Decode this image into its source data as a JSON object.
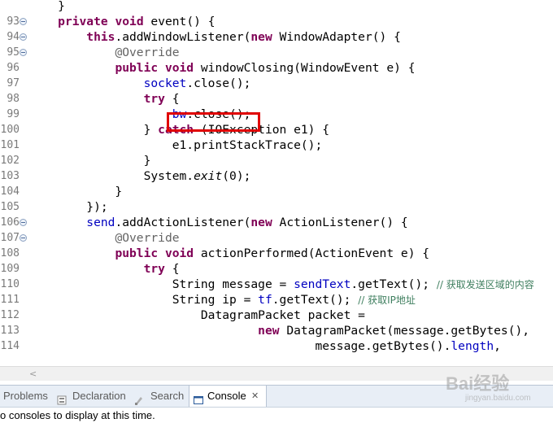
{
  "editor": {
    "lines": [
      {
        "n": "",
        "fold": false,
        "html": "    <span>}</span>"
      },
      {
        "n": "93",
        "fold": true,
        "html": "    <span class=\"kw\">private</span> <span class=\"kw\">void</span> event() {"
      },
      {
        "n": "94",
        "fold": true,
        "html": "        <span class=\"kw\">this</span>.addWindowListener(<span class=\"kw\">new</span> WindowAdapter() {"
      },
      {
        "n": "95",
        "fold": true,
        "html": "            <span class=\"ann\">@Override</span>"
      },
      {
        "n": "96",
        "fold": false,
        "html": "            <span class=\"kw\">public</span> <span class=\"kw\">void</span> windowClosing(WindowEvent e) {"
      },
      {
        "n": "97",
        "fold": false,
        "html": "                <span class=\"fld\">socket</span>.close();"
      },
      {
        "n": "98",
        "fold": false,
        "html": "                <span class=\"kw\">try</span> {"
      },
      {
        "n": "99",
        "fold": false,
        "html": "                    <span class=\"fld\">bw</span>.close();"
      },
      {
        "n": "100",
        "fold": false,
        "html": "                } <span class=\"kw\">catch</span> (IOException e1) {"
      },
      {
        "n": "101",
        "fold": false,
        "html": "                    e1.printStackTrace();"
      },
      {
        "n": "102",
        "fold": false,
        "html": "                }"
      },
      {
        "n": "103",
        "fold": false,
        "html": "                System.<span class=\"it\">exit</span>(0);"
      },
      {
        "n": "104",
        "fold": false,
        "html": "            }"
      },
      {
        "n": "105",
        "fold": false,
        "html": "        });"
      },
      {
        "n": "106",
        "fold": true,
        "html": "        <span class=\"fld\">send</span>.addActionListener(<span class=\"kw\">new</span> ActionListener() {"
      },
      {
        "n": "107",
        "fold": true,
        "html": "            <span class=\"ann\">@Override</span>"
      },
      {
        "n": "108",
        "fold": false,
        "html": "            <span class=\"kw\">public</span> <span class=\"kw\">void</span> actionPerformed(ActionEvent e) {"
      },
      {
        "n": "109",
        "fold": false,
        "html": "                <span class=\"kw\">try</span> {"
      },
      {
        "n": "110",
        "fold": false,
        "html": "                    String message = <span class=\"fld\">sendText</span>.getText(); <span class=\"cmt\">// 获取发送区域的内容</span>"
      },
      {
        "n": "111",
        "fold": false,
        "html": "                    String ip = <span class=\"fld\">tf</span>.getText(); <span class=\"cmt\">// 获取IP地址</span>"
      },
      {
        "n": "112",
        "fold": false,
        "html": "                        DatagramPacket packet ="
      },
      {
        "n": "113",
        "fold": false,
        "html": "                                <span class=\"kw\">new</span> DatagramPacket(message.getBytes(),"
      },
      {
        "n": "114",
        "fold": false,
        "html": "                                        message.getBytes().<span class=\"fld\">length</span>,"
      }
    ]
  },
  "tabs": [
    {
      "label": "Problems",
      "icon": "problems-icon",
      "active": false
    },
    {
      "label": "Declaration",
      "icon": "declaration-icon",
      "active": false
    },
    {
      "label": "Search",
      "icon": "search-icon",
      "active": false
    },
    {
      "label": "Console",
      "icon": "console-icon",
      "active": true,
      "close": "✕"
    }
  ],
  "status": {
    "text": "o consoles to display at this time."
  },
  "watermark": {
    "logo": "Bai经验",
    "sub": "jingyan.baidu.com"
  }
}
